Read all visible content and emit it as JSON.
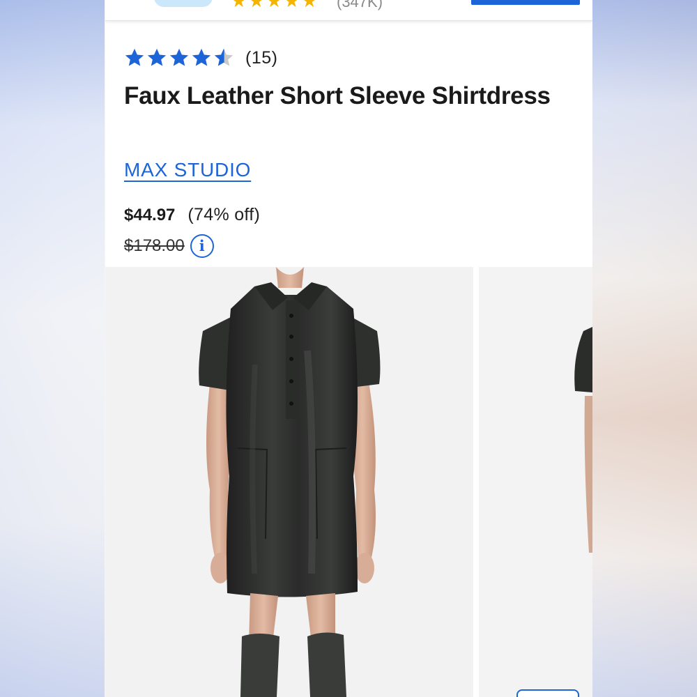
{
  "app_banner": {
    "rating_count": "(347K)"
  },
  "product": {
    "rating_value": 4.5,
    "review_count": "(15)",
    "title": "Faux Leather Short Sleeve Shirtdress",
    "brand": "MAX STUDIO",
    "sale_price": "$44.97",
    "discount": "(74% off)",
    "original_price": "$178.00",
    "info_icon_glyph": "i"
  },
  "colors": {
    "accent": "#1d64d8",
    "star": "#1d64d8",
    "app_star": "#f5b400",
    "dress": "#2b2d2b"
  },
  "icons": [
    "star-icon",
    "info-icon"
  ]
}
